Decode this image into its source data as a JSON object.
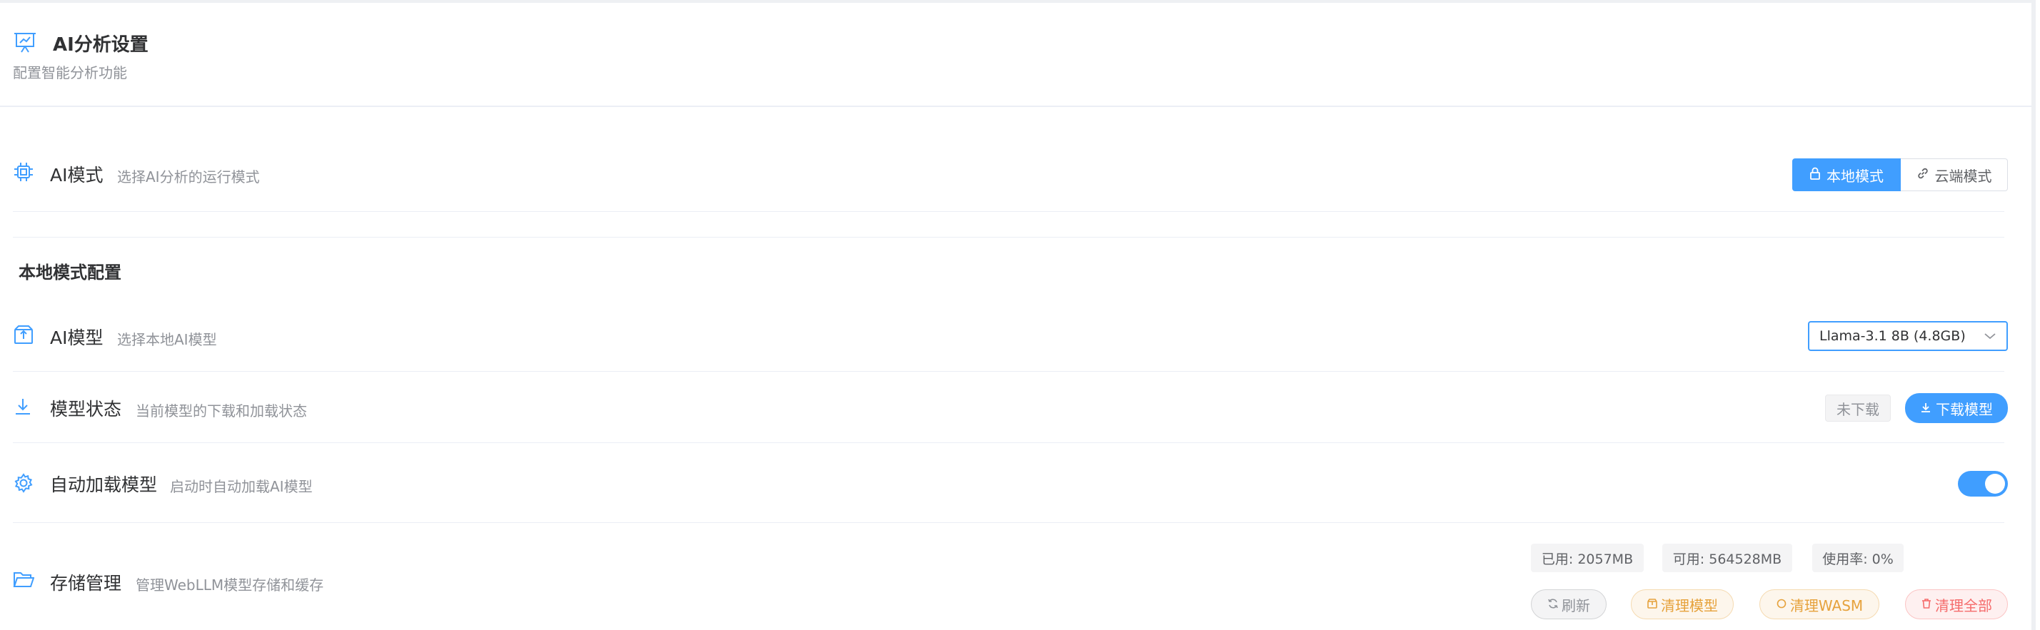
{
  "header": {
    "title": "AI分析设置",
    "subtitle": "配置智能分析功能",
    "icon": "presentation-chart-icon"
  },
  "ai_mode": {
    "label": "AI模式",
    "desc": "选择AI分析的运行模式",
    "icon": "cpu-chip-icon",
    "options": [
      {
        "label": "本地模式",
        "icon": "lock-icon",
        "active": true
      },
      {
        "label": "云端模式",
        "icon": "link-icon",
        "active": false
      }
    ]
  },
  "local_config": {
    "section_title": "本地模式配置",
    "model": {
      "label": "AI模型",
      "desc": "选择本地AI模型",
      "icon": "package-icon",
      "selected": "Llama-3.1 8B (4.8GB)"
    },
    "model_status": {
      "label": "模型状态",
      "desc": "当前模型的下载和加载状态",
      "icon": "download-icon",
      "status_tag": "未下载",
      "download_button": "下载模型"
    },
    "auto_load": {
      "label": "自动加载模型",
      "desc": "启动时自动加载AI模型",
      "icon": "gear-icon",
      "enabled": true
    },
    "storage": {
      "label": "存储管理",
      "desc": "管理WebLLM模型存储和缓存",
      "icon": "folder-open-icon",
      "used": "已用: 2057MB",
      "available": "可用: 564528MB",
      "usage_rate": "使用率: 0%",
      "buttons": {
        "refresh": "刷新",
        "clear_models": "清理模型",
        "clear_wasm": "清理WASM",
        "clear_all": "清理全部"
      }
    }
  },
  "colors": {
    "primary": "#409eff",
    "warning": "#e6a23c",
    "danger": "#f56c6c",
    "muted": "#909399"
  }
}
